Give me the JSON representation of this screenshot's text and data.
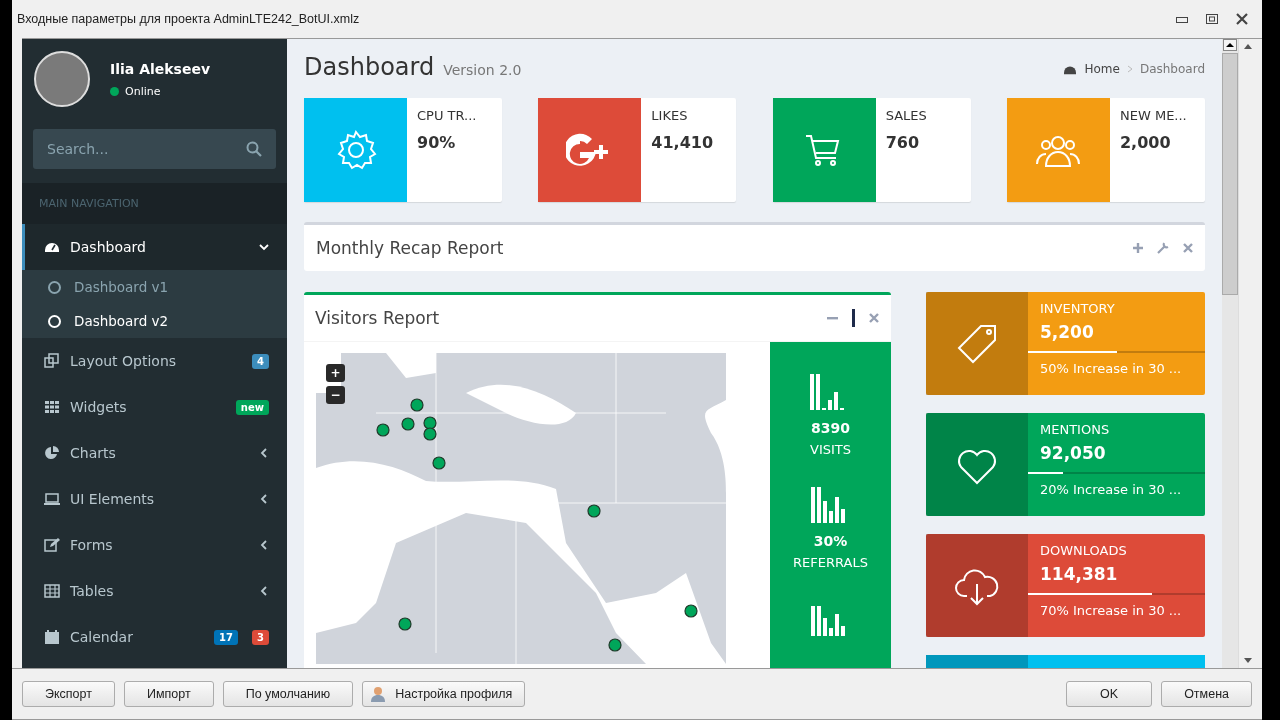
{
  "window": {
    "title": "Входные параметры для проекта AdminLTE242_BotUI.xmlz"
  },
  "sidebar": {
    "user": {
      "name": "Ilia Alekseev",
      "status": "Online"
    },
    "search": {
      "placeholder": "Search..."
    },
    "header": "MAIN NAVIGATION",
    "items": [
      {
        "label": "Dashboard",
        "selected": true,
        "expanded": true,
        "children": [
          {
            "label": "Dashboard v1",
            "selected": false
          },
          {
            "label": "Dashboard v2",
            "selected": true
          }
        ]
      },
      {
        "label": "Layout Options",
        "selected": false,
        "badges": [
          {
            "text": "4",
            "color": "#3c8dbc"
          }
        ]
      },
      {
        "label": "Widgets",
        "selected": false,
        "badges": [
          {
            "text": "new",
            "color": "#00a65a"
          }
        ]
      },
      {
        "label": "Charts",
        "selected": false,
        "expanded": false
      },
      {
        "label": "UI Elements",
        "selected": false,
        "expanded": false
      },
      {
        "label": "Forms",
        "selected": false,
        "expanded": false
      },
      {
        "label": "Tables",
        "selected": false,
        "expanded": false
      },
      {
        "label": "Calendar",
        "selected": false,
        "badges": [
          {
            "text": "17",
            "color": "#0073b7"
          },
          {
            "text": "3",
            "color": "#dd4b39"
          }
        ]
      }
    ]
  },
  "content": {
    "title": "Dashboard",
    "subtitle": "Version 2.0",
    "breadcrumb": [
      "Home",
      "Dashboard"
    ],
    "info_boxes": [
      {
        "label": "CPU TR...",
        "value": "90%",
        "color": "#00c0ef"
      },
      {
        "label": "LIKES",
        "value": "41,410",
        "color": "#dd4b39"
      },
      {
        "label": "SALES",
        "value": "760",
        "color": "#00a65a"
      },
      {
        "label": "NEW ME...",
        "value": "2,000",
        "color": "#f39c12"
      }
    ],
    "recap": {
      "title": "Monthly Recap Report"
    },
    "visitors": {
      "title": "Visitors Report",
      "zoom_in": "+",
      "zoom_out": "−",
      "stats": [
        {
          "value": "8390",
          "label": "VISITS"
        },
        {
          "value": "30%",
          "label": "REFERRALS"
        }
      ]
    },
    "progress_boxes": [
      {
        "label": "INVENTORY",
        "value": "5,200",
        "level": 0.5,
        "description": "50% Increase in 30 ...",
        "color": "#f39c12"
      },
      {
        "label": "MENTIONS",
        "value": "92,050",
        "level": 0.2,
        "description": "20% Increase in 30 ...",
        "color": "#00a65a"
      },
      {
        "label": "DOWNLOADS",
        "value": "114,381",
        "level": 0.7,
        "description": "70% Increase in 30 ...",
        "color": "#dd4b39"
      }
    ]
  },
  "footer": {
    "left_buttons": [
      "Экспорт",
      "Импорт",
      "По умолчанию"
    ],
    "profile_button": "Настройка профиля",
    "right_buttons": [
      "OK",
      "Отмена"
    ]
  }
}
